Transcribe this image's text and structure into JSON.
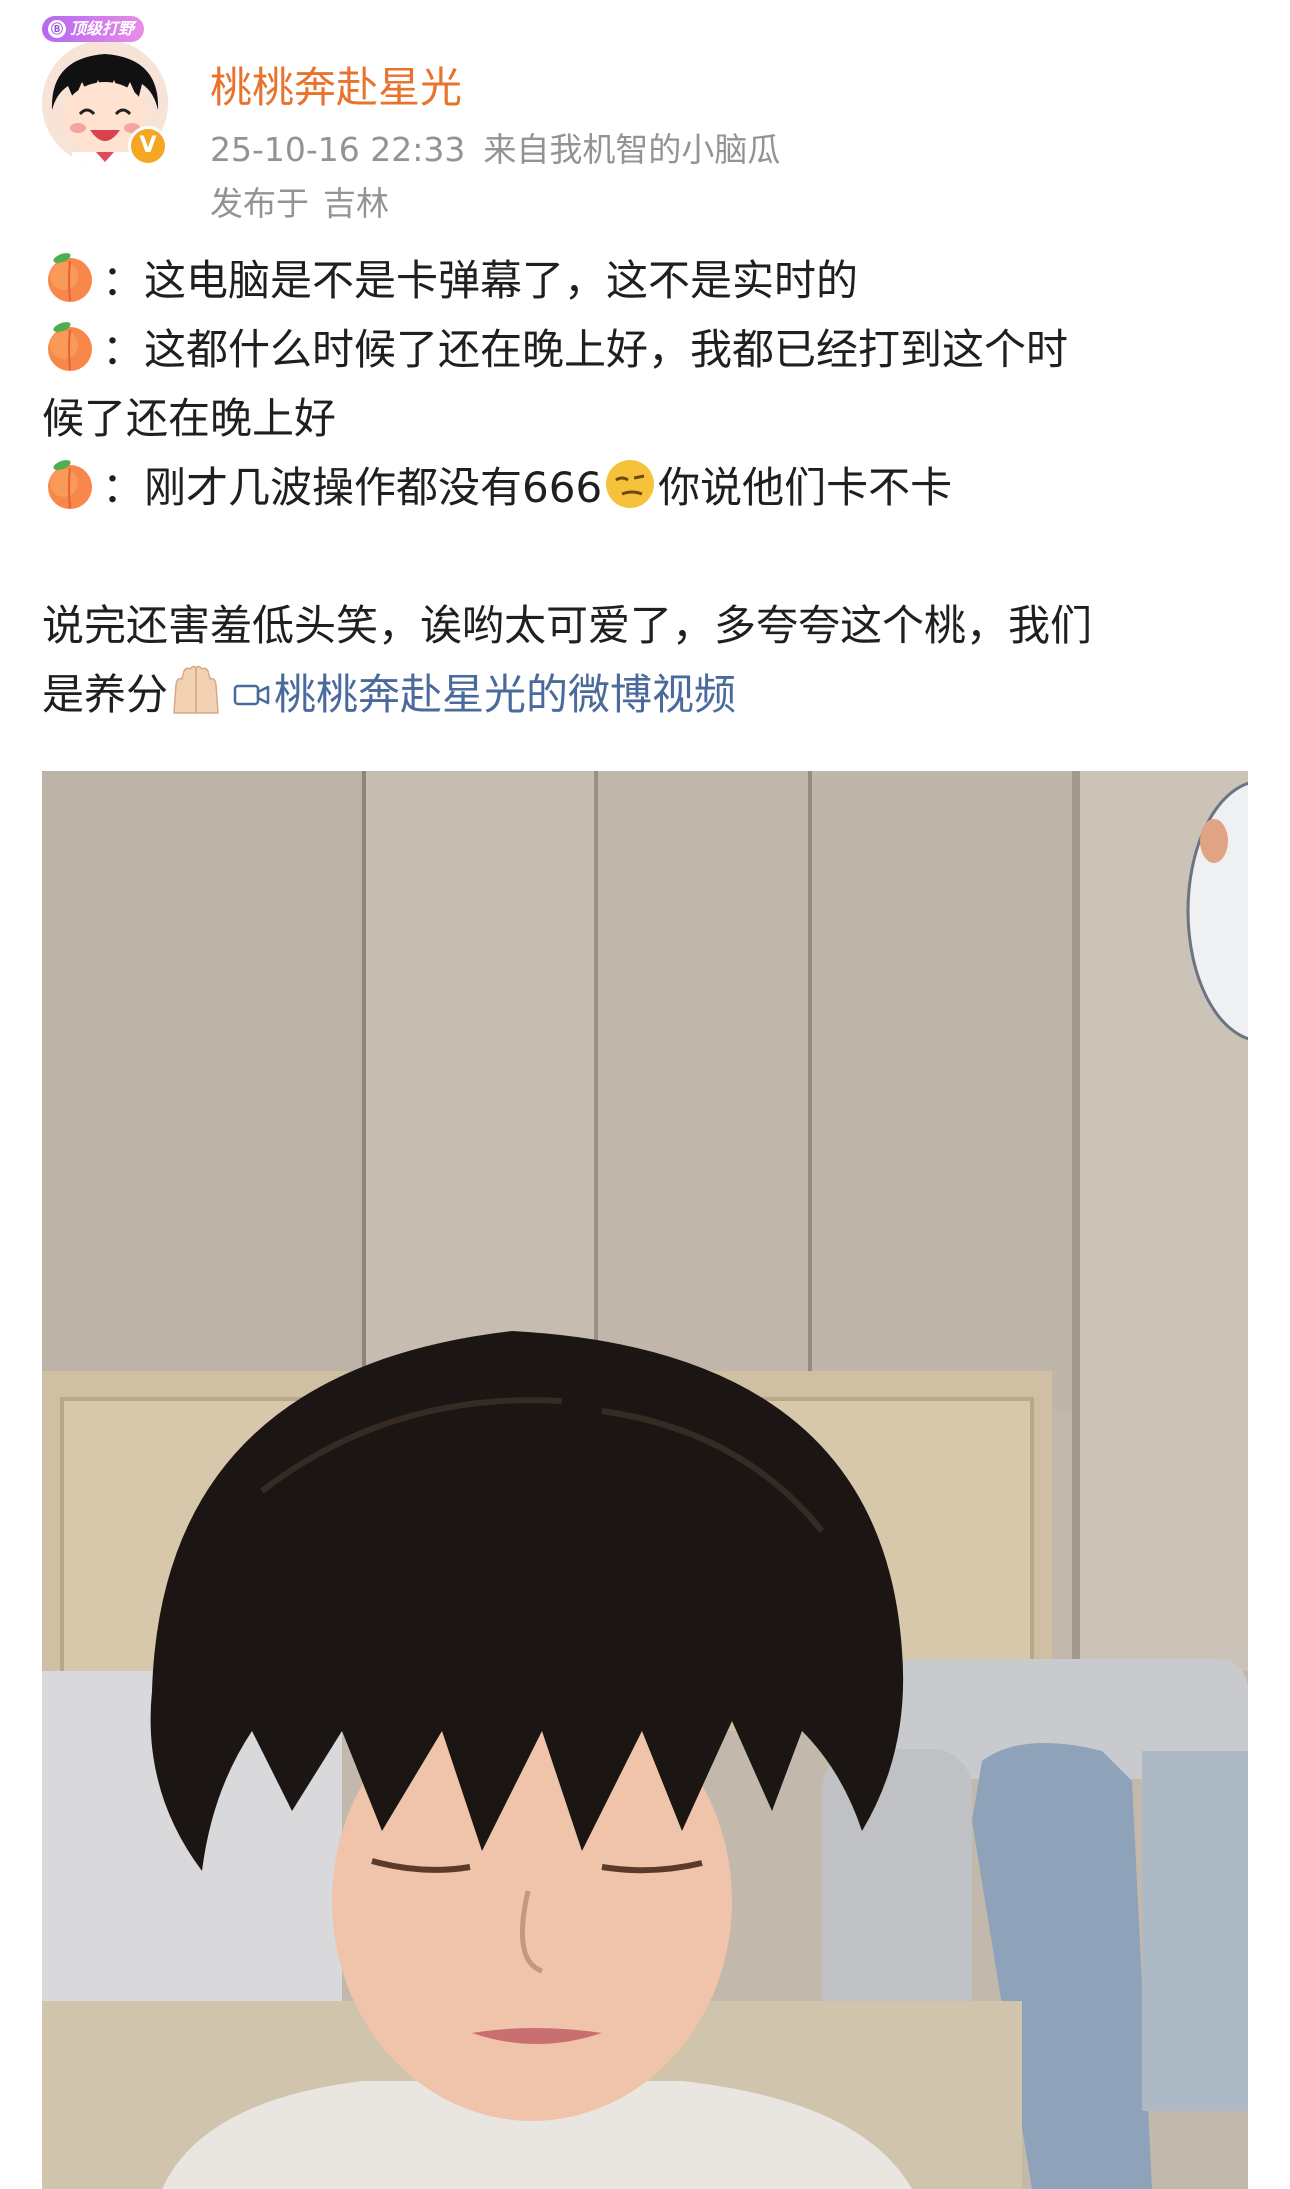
{
  "header": {
    "username": "桃桃奔赴星光",
    "timestamp": "25-10-16 22:33",
    "source": "来自我机智的小脑瓜",
    "location_prefix": "发布于",
    "location": "吉林",
    "avatar_badge": "顶级打野",
    "avatar_badge_icon": "Ⓑ",
    "verified_mark": "V"
  },
  "post": {
    "line1": "：这电脑是不是卡弹幕了，这不是实时的",
    "line2a": "：这都什么时候了还在晚上好，我都已经打到这个时",
    "line2b": "候了还在晚上好",
    "line3a": "：刚才几波操作都没有666",
    "line3b": "你说他们卡不卡",
    "line4a": "说完还害羞低头笑，诶哟太可爱了，多夸夸这个桃，我们",
    "line4b": "是养分",
    "video_link_label": "桃桃奔赴星光的微博视频"
  },
  "icons": {
    "prefix_emoji": "peach-icon",
    "thinking_emoji": "sly-face-icon",
    "praise_emoji": "raised-hands-icon",
    "video_link_icon": "video-camera-icon"
  },
  "colors": {
    "username": "#e8732c",
    "link": "#4a6a9c",
    "meta": "#939393",
    "text": "#1f1f1f",
    "verified_badge": "#f5a623"
  }
}
